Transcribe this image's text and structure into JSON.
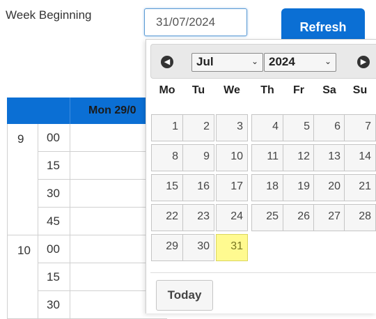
{
  "toolbar": {
    "week_beginning_label": "Week Beginning",
    "date_value": "31/07/2024",
    "refresh_label": "Refresh"
  },
  "schedule": {
    "day_header": "Mon 29/0",
    "hours": [
      {
        "hour": "9",
        "minutes": [
          "00",
          "15",
          "30",
          "45"
        ]
      },
      {
        "hour": "10",
        "minutes": [
          "00",
          "15",
          "30"
        ]
      }
    ]
  },
  "datepicker": {
    "prev_icon": "chevron-left-circle-icon",
    "next_icon": "chevron-right-circle-icon",
    "month_selected": "Jul",
    "year_selected": "2024",
    "weekdays": [
      "Mo",
      "Tu",
      "We",
      "Th",
      "Fr",
      "Sa",
      "Su"
    ],
    "weeks": [
      [
        "1",
        "2",
        "3",
        "4",
        "5",
        "6",
        "7"
      ],
      [
        "8",
        "9",
        "10",
        "11",
        "12",
        "13",
        "14"
      ],
      [
        "15",
        "16",
        "17",
        "18",
        "19",
        "20",
        "21"
      ],
      [
        "22",
        "23",
        "24",
        "25",
        "26",
        "27",
        "28"
      ],
      [
        "29",
        "30",
        "31"
      ]
    ],
    "highlighted_day": "31",
    "today_label": "Today"
  },
  "colors": {
    "primary": "#0b6fd4",
    "highlight": "#fffa90",
    "cell_background": "#f6f6f6"
  }
}
